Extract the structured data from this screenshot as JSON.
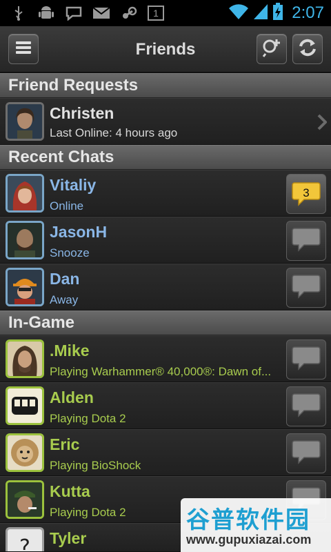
{
  "status_bar": {
    "time": "2:07",
    "notification_count": "1",
    "icons": [
      "usb-icon",
      "android-debug-icon",
      "chat-notification-icon",
      "gmail-icon",
      "steam-icon",
      "notification-count-icon",
      "wifi-icon",
      "signal-icon",
      "battery-charging-icon"
    ]
  },
  "header": {
    "title": "Friends",
    "menu_icon": "menu-icon",
    "search_icon": "add-friend-search-icon",
    "refresh_icon": "refresh-icon"
  },
  "sections": {
    "friend_requests": "Friend Requests",
    "recent_chats": "Recent Chats",
    "in_game": "In-Game"
  },
  "friend_requests": [
    {
      "name": "Christen",
      "status": "Last Online: 4 hours ago"
    }
  ],
  "recent_chats": [
    {
      "name": "Vitaliy",
      "status": "Online",
      "unread": "3"
    },
    {
      "name": "JasonH",
      "status": "Snooze"
    },
    {
      "name": "Dan",
      "status": "Away"
    }
  ],
  "in_game": [
    {
      "name": ".Mike",
      "status": "Playing Warhammer® 40,000®: Dawn of..."
    },
    {
      "name": "Alden",
      "status": "Playing Dota 2"
    },
    {
      "name": "Eric",
      "status": "Playing BioShock"
    },
    {
      "name": "Kutta",
      "status": "Playing Dota 2"
    },
    {
      "name": "Tyler",
      "status": ""
    }
  ],
  "watermark": {
    "text": "谷普软件园",
    "url": "www.gupuxiazai.com"
  },
  "colors": {
    "online": "#8ab6e6",
    "ingame": "#a8cc4e",
    "time": "#3fb5e8",
    "unread_bubble": "#f2c63a"
  }
}
